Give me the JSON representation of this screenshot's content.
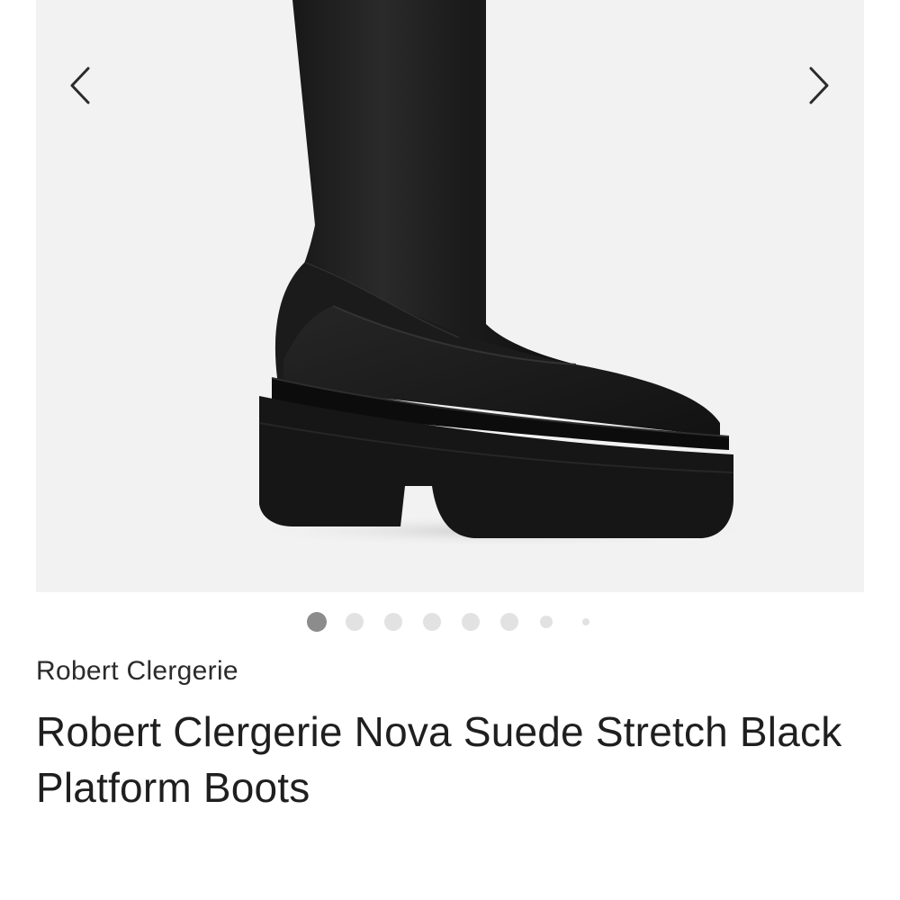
{
  "gallery": {
    "image_alt": "Black platform boot",
    "prev_icon": "chevron-left-icon",
    "next_icon": "chevron-right-icon",
    "total_images": 8,
    "active_index": 0,
    "colors": {
      "background": "#f2f2f2",
      "dot_active": "#8c8c8c",
      "dot_inactive": "#e2e2e2"
    }
  },
  "product": {
    "brand": "Robert Clergerie",
    "title": "Robert Clergerie Nova Suede Stretch Black Platform Boots"
  }
}
